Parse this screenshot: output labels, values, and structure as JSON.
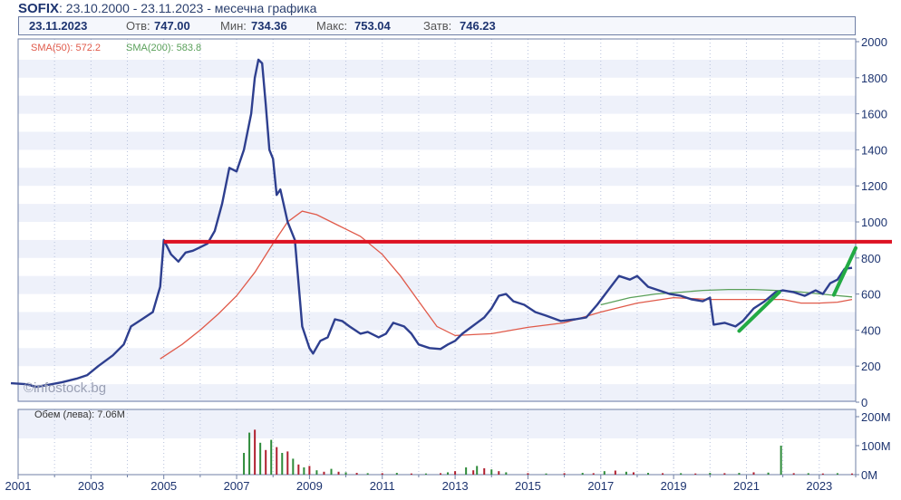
{
  "header": {
    "symbol": "SOFIX",
    "subtitle": ": 23.10.2000 - 23.11.2023 - месечна графика"
  },
  "quote": {
    "date": "23.11.2023",
    "open_label": "Отв:",
    "open": "747.00",
    "min_label": "Мин:",
    "min": "734.36",
    "max_label": "Макс:",
    "max": "753.04",
    "close_label": "Затв:",
    "close": "746.23"
  },
  "legend": {
    "sma50": "SMA(50): 572.2",
    "sma200": "SMA(200): 583.8",
    "volume": "Обем (лева): 7.06M"
  },
  "watermark": "©infostock.bg",
  "colors": {
    "price": "#2e3f8f",
    "sma50": "#e05a4a",
    "sma200": "#5aa05a",
    "hline": "#dd1122",
    "trend": "#22aa44",
    "volume_up": "#2e8b3a",
    "volume_down": "#b02030"
  },
  "chart_data": [
    {
      "type": "line",
      "x_axis": {
        "min": 2001.0,
        "max": 2024.0,
        "ticks": [
          "2001",
          "2003",
          "2005",
          "2007",
          "2009",
          "2011",
          "2013",
          "2015",
          "2017",
          "2019",
          "2021",
          "2023"
        ]
      },
      "y_axis": {
        "min": 0,
        "max": 2000,
        "ticks": [
          0,
          200,
          400,
          600,
          800,
          1000,
          1200,
          1400,
          1600,
          1800,
          2000
        ],
        "side": "right"
      },
      "grid": "horizontal bands + vertical dotted",
      "series": [
        {
          "name": "SOFIX",
          "points": [
            [
              2000.8,
              105
            ],
            [
              2001.2,
              100
            ],
            [
              2001.5,
              85
            ],
            [
              2001.8,
              95
            ],
            [
              2002.2,
              110
            ],
            [
              2002.6,
              130
            ],
            [
              2002.9,
              150
            ],
            [
              2003.2,
              200
            ],
            [
              2003.6,
              260
            ],
            [
              2003.9,
              320
            ],
            [
              2004.1,
              420
            ],
            [
              2004.4,
              460
            ],
            [
              2004.7,
              500
            ],
            [
              2004.9,
              640
            ],
            [
              2005.0,
              900
            ],
            [
              2005.2,
              820
            ],
            [
              2005.4,
              780
            ],
            [
              2005.6,
              830
            ],
            [
              2005.8,
              840
            ],
            [
              2006.0,
              860
            ],
            [
              2006.2,
              880
            ],
            [
              2006.4,
              950
            ],
            [
              2006.6,
              1100
            ],
            [
              2006.8,
              1300
            ],
            [
              2007.0,
              1280
            ],
            [
              2007.2,
              1400
            ],
            [
              2007.4,
              1600
            ],
            [
              2007.5,
              1800
            ],
            [
              2007.6,
              1900
            ],
            [
              2007.7,
              1880
            ],
            [
              2007.8,
              1650
            ],
            [
              2007.9,
              1400
            ],
            [
              2008.0,
              1350
            ],
            [
              2008.1,
              1150
            ],
            [
              2008.2,
              1180
            ],
            [
              2008.4,
              1000
            ],
            [
              2008.6,
              900
            ],
            [
              2008.8,
              420
            ],
            [
              2009.0,
              300
            ],
            [
              2009.1,
              270
            ],
            [
              2009.3,
              340
            ],
            [
              2009.5,
              360
            ],
            [
              2009.7,
              460
            ],
            [
              2009.9,
              450
            ],
            [
              2010.1,
              420
            ],
            [
              2010.4,
              380
            ],
            [
              2010.6,
              390
            ],
            [
              2010.9,
              360
            ],
            [
              2011.1,
              380
            ],
            [
              2011.3,
              440
            ],
            [
              2011.6,
              420
            ],
            [
              2011.8,
              380
            ],
            [
              2012.0,
              320
            ],
            [
              2012.3,
              300
            ],
            [
              2012.6,
              295
            ],
            [
              2012.8,
              320
            ],
            [
              2013.0,
              340
            ],
            [
              2013.2,
              380
            ],
            [
              2013.4,
              410
            ],
            [
              2013.6,
              440
            ],
            [
              2013.8,
              470
            ],
            [
              2014.0,
              520
            ],
            [
              2014.2,
              590
            ],
            [
              2014.4,
              600
            ],
            [
              2014.6,
              560
            ],
            [
              2014.9,
              540
            ],
            [
              2015.2,
              500
            ],
            [
              2015.5,
              480
            ],
            [
              2015.9,
              450
            ],
            [
              2016.3,
              460
            ],
            [
              2016.6,
              470
            ],
            [
              2016.9,
              540
            ],
            [
              2017.2,
              620
            ],
            [
              2017.5,
              700
            ],
            [
              2017.8,
              680
            ],
            [
              2018.0,
              700
            ],
            [
              2018.3,
              640
            ],
            [
              2018.6,
              620
            ],
            [
              2018.9,
              600
            ],
            [
              2019.2,
              590
            ],
            [
              2019.5,
              570
            ],
            [
              2019.8,
              560
            ],
            [
              2020.0,
              580
            ],
            [
              2020.1,
              430
            ],
            [
              2020.4,
              440
            ],
            [
              2020.7,
              420
            ],
            [
              2020.9,
              450
            ],
            [
              2021.2,
              520
            ],
            [
              2021.5,
              560
            ],
            [
              2021.8,
              610
            ],
            [
              2022.0,
              620
            ],
            [
              2022.3,
              610
            ],
            [
              2022.6,
              590
            ],
            [
              2022.9,
              620
            ],
            [
              2023.1,
              600
            ],
            [
              2023.3,
              660
            ],
            [
              2023.5,
              680
            ],
            [
              2023.7,
              740
            ],
            [
              2023.9,
              745
            ]
          ]
        },
        {
          "name": "SMA(50)",
          "points": [
            [
              2004.9,
              240
            ],
            [
              2005.5,
              320
            ],
            [
              2006.0,
              400
            ],
            [
              2006.5,
              490
            ],
            [
              2007.0,
              590
            ],
            [
              2007.5,
              720
            ],
            [
              2008.0,
              880
            ],
            [
              2008.4,
              1000
            ],
            [
              2008.8,
              1060
            ],
            [
              2009.2,
              1040
            ],
            [
              2009.8,
              980
            ],
            [
              2010.4,
              920
            ],
            [
              2011.0,
              820
            ],
            [
              2011.5,
              700
            ],
            [
              2012.0,
              560
            ],
            [
              2012.5,
              420
            ],
            [
              2013.0,
              370
            ],
            [
              2013.5,
              375
            ],
            [
              2014.0,
              380
            ],
            [
              2015.0,
              415
            ],
            [
              2016.0,
              440
            ],
            [
              2017.0,
              500
            ],
            [
              2018.0,
              550
            ],
            [
              2019.0,
              580
            ],
            [
              2020.0,
              570
            ],
            [
              2021.0,
              570
            ],
            [
              2022.0,
              570
            ],
            [
              2022.5,
              550
            ],
            [
              2023.0,
              550
            ],
            [
              2023.5,
              555
            ],
            [
              2023.9,
              570
            ]
          ]
        },
        {
          "name": "SMA(200)",
          "points": [
            [
              2017.0,
              540
            ],
            [
              2017.8,
              580
            ],
            [
              2018.5,
              600
            ],
            [
              2019.2,
              610
            ],
            [
              2019.8,
              620
            ],
            [
              2020.5,
              625
            ],
            [
              2021.2,
              625
            ],
            [
              2021.8,
              620
            ],
            [
              2022.3,
              615
            ],
            [
              2022.8,
              605
            ],
            [
              2023.3,
              595
            ],
            [
              2023.9,
              584
            ]
          ]
        }
      ],
      "annotations": {
        "horizontal_line": 890,
        "trendlines": [
          [
            [
              2020.8,
              395
            ],
            [
              2021.9,
              610
            ]
          ],
          [
            [
              2023.4,
              595
            ],
            [
              2024.0,
              855
            ]
          ]
        ]
      }
    },
    {
      "type": "bar",
      "name": "Volume",
      "y_axis": {
        "min": 0,
        "max": 200,
        "ticks": [
          "0M",
          "100M",
          "200M"
        ],
        "side": "right"
      },
      "bars": [
        [
          2007.2,
          75,
          "up"
        ],
        [
          2007.35,
          145,
          "up"
        ],
        [
          2007.5,
          155,
          "down"
        ],
        [
          2007.65,
          110,
          "up"
        ],
        [
          2007.8,
          85,
          "down"
        ],
        [
          2007.95,
          120,
          "up"
        ],
        [
          2008.1,
          95,
          "down"
        ],
        [
          2008.25,
          75,
          "up"
        ],
        [
          2008.4,
          80,
          "down"
        ],
        [
          2008.55,
          55,
          "up"
        ],
        [
          2008.7,
          35,
          "down"
        ],
        [
          2008.85,
          25,
          "up"
        ],
        [
          2009.0,
          30,
          "down"
        ],
        [
          2009.2,
          15,
          "up"
        ],
        [
          2009.4,
          10,
          "down"
        ],
        [
          2009.6,
          20,
          "up"
        ],
        [
          2009.8,
          10,
          "down"
        ],
        [
          2010.0,
          8,
          "up"
        ],
        [
          2010.3,
          6,
          "down"
        ],
        [
          2010.6,
          5,
          "up"
        ],
        [
          2011.0,
          5,
          "down"
        ],
        [
          2011.4,
          6,
          "up"
        ],
        [
          2011.8,
          4,
          "down"
        ],
        [
          2012.2,
          4,
          "up"
        ],
        [
          2012.6,
          5,
          "down"
        ],
        [
          2012.8,
          8,
          "up"
        ],
        [
          2013.0,
          12,
          "down"
        ],
        [
          2013.3,
          25,
          "up"
        ],
        [
          2013.5,
          15,
          "down"
        ],
        [
          2013.6,
          30,
          "up"
        ],
        [
          2013.8,
          22,
          "down"
        ],
        [
          2014.0,
          18,
          "up"
        ],
        [
          2014.2,
          12,
          "down"
        ],
        [
          2014.4,
          8,
          "up"
        ],
        [
          2015.0,
          5,
          "down"
        ],
        [
          2015.5,
          4,
          "up"
        ],
        [
          2016.0,
          5,
          "down"
        ],
        [
          2016.5,
          6,
          "up"
        ],
        [
          2016.8,
          5,
          "down"
        ],
        [
          2017.1,
          12,
          "up"
        ],
        [
          2017.4,
          14,
          "down"
        ],
        [
          2017.7,
          10,
          "up"
        ],
        [
          2017.9,
          8,
          "down"
        ],
        [
          2018.3,
          6,
          "up"
        ],
        [
          2018.7,
          5,
          "down"
        ],
        [
          2019.2,
          5,
          "up"
        ],
        [
          2019.6,
          4,
          "down"
        ],
        [
          2020.0,
          6,
          "up"
        ],
        [
          2020.4,
          5,
          "down"
        ],
        [
          2020.8,
          6,
          "up"
        ],
        [
          2021.2,
          8,
          "down"
        ],
        [
          2021.6,
          7,
          "up"
        ],
        [
          2021.95,
          100,
          "up"
        ],
        [
          2022.3,
          5,
          "down"
        ],
        [
          2022.7,
          5,
          "up"
        ],
        [
          2023.1,
          4,
          "down"
        ],
        [
          2023.5,
          5,
          "up"
        ],
        [
          2023.9,
          4,
          "down"
        ]
      ],
      "bars_note": "values in millions of leva"
    }
  ]
}
